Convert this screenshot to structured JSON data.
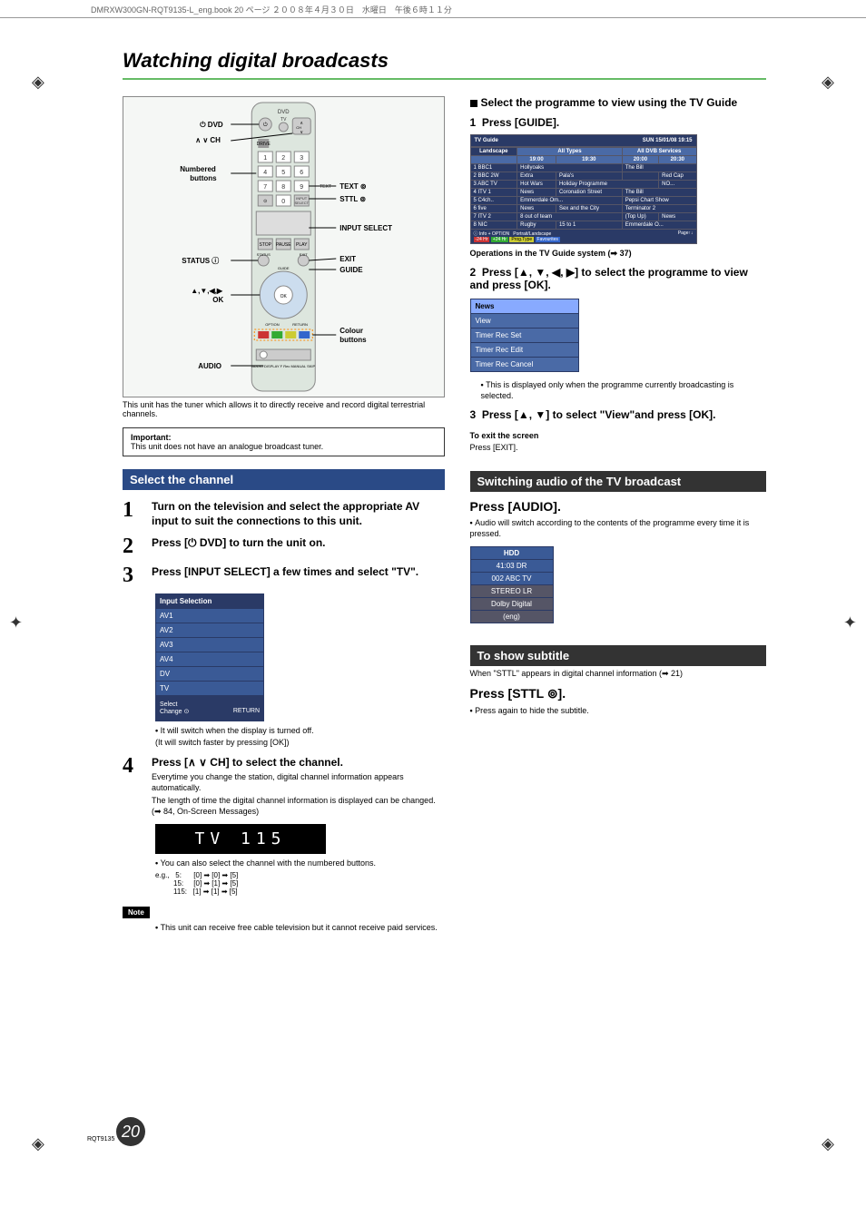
{
  "header_bar": "DMRXW300GN-RQT9135-L_eng.book  20 ページ  ２００８年４月３０日　水曜日　午後６時１１分",
  "title": "Watching digital broadcasts",
  "remote_labels": {
    "dvd": "DVD",
    "ch": "CH",
    "numbered": "Numbered buttons",
    "text": "TEXT",
    "sttl": "STTL",
    "input_select": "INPUT SELECT",
    "status": "STATUS",
    "exit": "EXIT",
    "guide": "GUIDE",
    "arrows_ok": "▲,▼,◀,▶\nOK",
    "colour": "Colour buttons",
    "audio": "AUDIO"
  },
  "under_remote": "This unit has the tuner which allows it to directly receive and record digital terrestrial channels.",
  "important_label": "Important:",
  "important_body": "This unit does not have an analogue broadcast tuner.",
  "select_channel_h": "Select the channel",
  "step1": "Turn on the television and select the appropriate AV input to suit the connections to this unit.",
  "step2_pre": "Press [",
  "step2_post": " DVD] to turn the unit on.",
  "step3": "Press [INPUT SELECT] a few times and select \"TV\".",
  "input_selection": {
    "header": "Input Selection",
    "rows": [
      "AV1",
      "AV2",
      "AV3",
      "AV4",
      "DV",
      "TV"
    ],
    "foot1": "Select",
    "foot2": "Change",
    "foot3": "RETURN"
  },
  "step3_note1": "It will switch when the display is turned off.",
  "step3_note2": "(It will switch faster by pressing [OK])",
  "step4_pre": "Press [",
  "step4_post": " CH] to select the channel.",
  "step4_sub1": "Everytime you change the station, digital channel information appears automatically.",
  "step4_sub2": "The length of time the digital channel information is displayed can be changed. (➡ 84, On-Screen Messages)",
  "segdisp": "TV  115",
  "step4_bul1": "You can also select the channel with the numbered buttons.",
  "ch_examples": {
    "prefix": "e.g.,",
    "rows": [
      {
        "label": "5:",
        "seq": "[0] ➡ [0] ➡ [5]"
      },
      {
        "label": "15:",
        "seq": "[0] ➡ [1] ➡ [5]"
      },
      {
        "label": "115:",
        "seq": "[1] ➡ [1] ➡ [5]"
      }
    ]
  },
  "note_tag": "Note",
  "note_body": "This unit can receive free cable television but it cannot receive paid services.",
  "r_sel_prog": "Select the programme to view using the TV Guide",
  "r_step1": "Press [GUIDE].",
  "tvguide": {
    "title": "TV Guide",
    "datetime": "SUN 15/01/08 19:15",
    "view": "Landscape",
    "type": "All Types",
    "services": "All DVB Services",
    "timeslots": [
      "19:00",
      "19:30",
      "20:00",
      "20:30"
    ],
    "rows": [
      {
        "num": "1",
        "ch": "BBC1",
        "c": [
          "Hollyoaks",
          "The Bill"
        ]
      },
      {
        "num": "2",
        "ch": "BBC 2W",
        "c": [
          "Extra",
          "Pala's",
          " ",
          "Red Cap"
        ]
      },
      {
        "num": "3",
        "ch": "ABC TV",
        "c": [
          "Hot Wars",
          "Holiday Programme",
          "NO..."
        ]
      },
      {
        "num": "4",
        "ch": "ITV 1",
        "c": [
          "News",
          "Coronation Street",
          "The Bill"
        ]
      },
      {
        "num": "5",
        "ch": "C4ch..",
        "c": [
          "Emmerdale Om...",
          "Pepsi Chart Show"
        ]
      },
      {
        "num": "6",
        "ch": "five",
        "c": [
          "News",
          "Sex and the City",
          "Terminator 2"
        ]
      },
      {
        "num": "7",
        "ch": "ITV 2",
        "c": [
          "8 out of team",
          "(Top Up)",
          "News"
        ]
      },
      {
        "num": "8",
        "ch": "NIC",
        "c": [
          "Rugby",
          "15 to 1",
          "Emmerdale O..."
        ]
      }
    ],
    "hint_info": "Info   + OPTION",
    "hint_pl": "Portrait/Landscape",
    "hint_page": "Page↑↓",
    "legend": [
      "-24 Hr",
      "+24 Hr",
      "Prog.Type",
      "Favourites"
    ]
  },
  "r_ops_line": "Operations in the TV Guide system (➡ 37)",
  "r_step2": "Press [▲, ▼, ◀, ▶] to select the programme to view and press [OK].",
  "mini_news": [
    "News",
    "View",
    "Timer Rec Set",
    "Timer Rec Edit",
    "Timer Rec Cancel"
  ],
  "r_step2_note": "This is displayed only when the programme currently broadcasting is selected.",
  "r_step3": "Press [▲, ▼] to select \"View\"and press [OK].",
  "r_exit_h": "To exit the screen",
  "r_exit_b": "Press [EXIT].",
  "switch_audio_h": "Switching audio of the TV broadcast",
  "press_audio": "Press [AUDIO].",
  "audio_note": "Audio will switch according to the contents of the programme every time it is pressed.",
  "hdd": [
    "HDD",
    "41:03 DR",
    "002 ABC TV",
    "STEREO LR",
    "Dolby Digital",
    "(eng)"
  ],
  "subtitle_h": "To show subtitle",
  "subtitle_pre": "When \"STTL\" appears in digital channel information (➡ 21)",
  "press_sttl": "Press [STTL ⊚].",
  "sttl_note": "Press again to hide the subtitle.",
  "page_num": "20",
  "rqt": "RQT9135",
  "power_icon": "⏻",
  "ch_icon": "∧ ∨"
}
